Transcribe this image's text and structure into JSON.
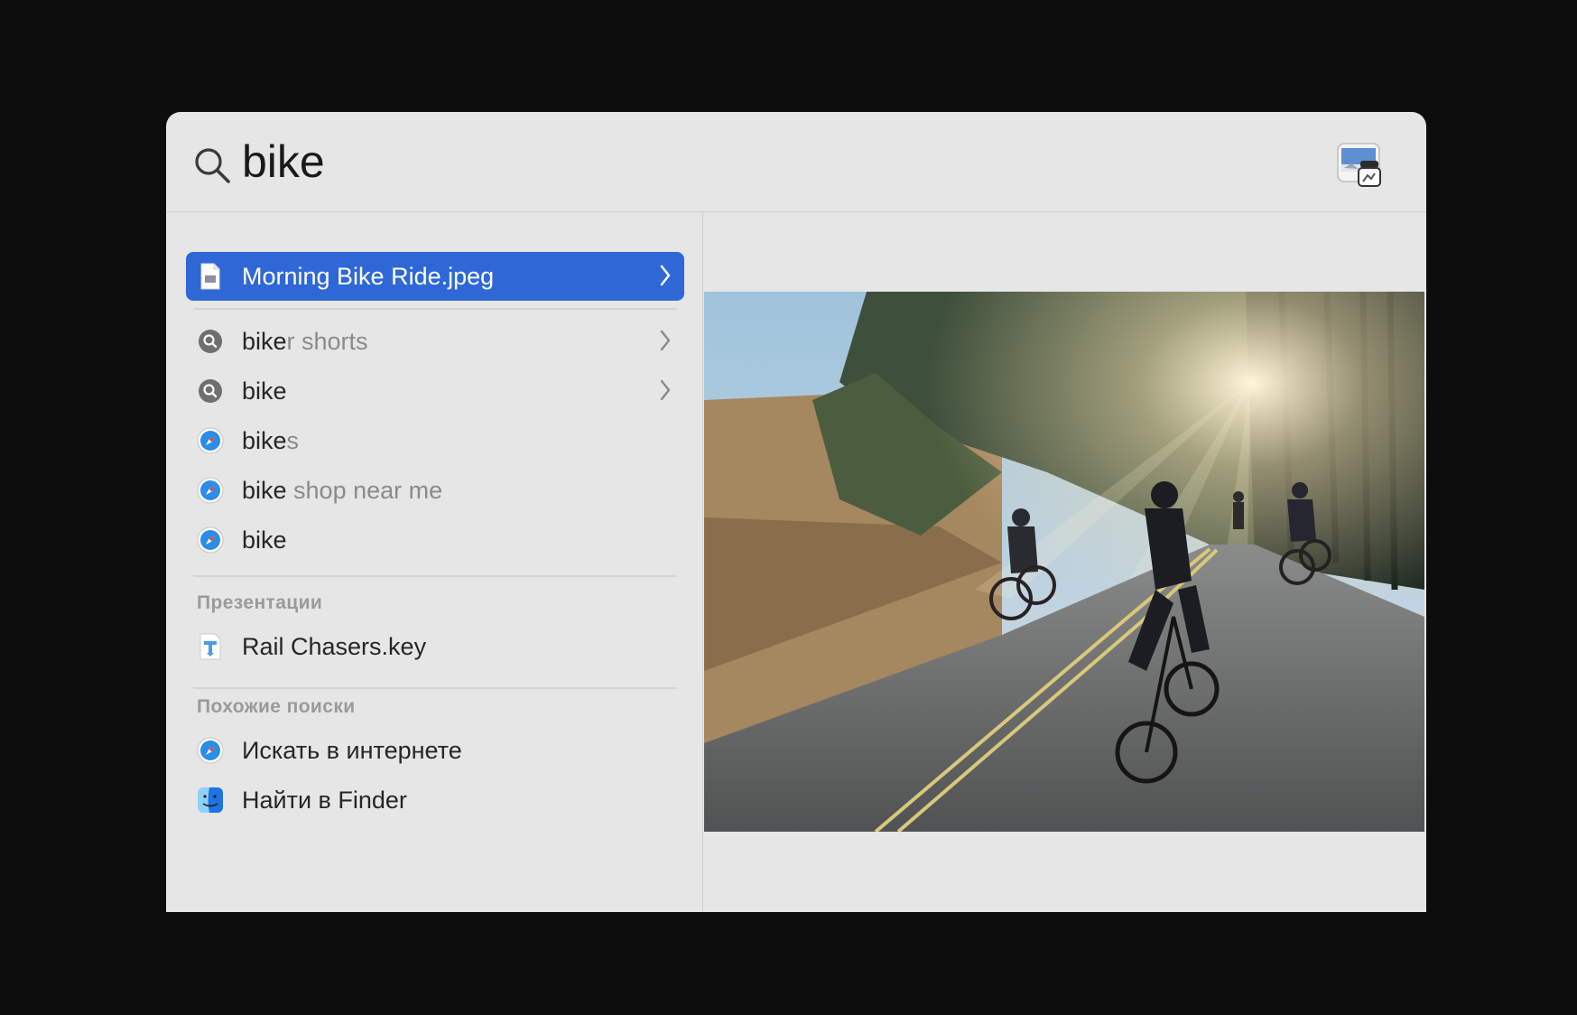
{
  "search": {
    "query": "bike"
  },
  "selected": {
    "label": "Morning Bike Ride.jpeg"
  },
  "suggestions": [
    {
      "match": "bike",
      "hint": "r shorts",
      "icon": "magnifier-suggestion-icon",
      "chevron": true
    },
    {
      "match": "bike",
      "hint": "",
      "icon": "magnifier-suggestion-icon",
      "chevron": true
    },
    {
      "match": "bike",
      "hint": "s",
      "icon": "safari-icon",
      "chevron": false
    },
    {
      "match": "bike",
      "hint": " shop near me",
      "icon": "safari-icon",
      "chevron": false
    },
    {
      "match": "bike",
      "hint": "",
      "icon": "safari-icon",
      "chevron": false
    }
  ],
  "presentations": {
    "title": "Презентации",
    "items": [
      {
        "label": "Rail Chasers.key",
        "icon": "keynote-icon"
      }
    ]
  },
  "related": {
    "title": "Похожие поиски",
    "items": [
      {
        "label": "Искать в интернете",
        "icon": "safari-icon"
      },
      {
        "label": "Найти в Finder",
        "icon": "finder-icon"
      }
    ]
  },
  "colors": {
    "selection": "#2f68d6",
    "background": "#e6e6e6",
    "hint": "#8a8a8a"
  }
}
